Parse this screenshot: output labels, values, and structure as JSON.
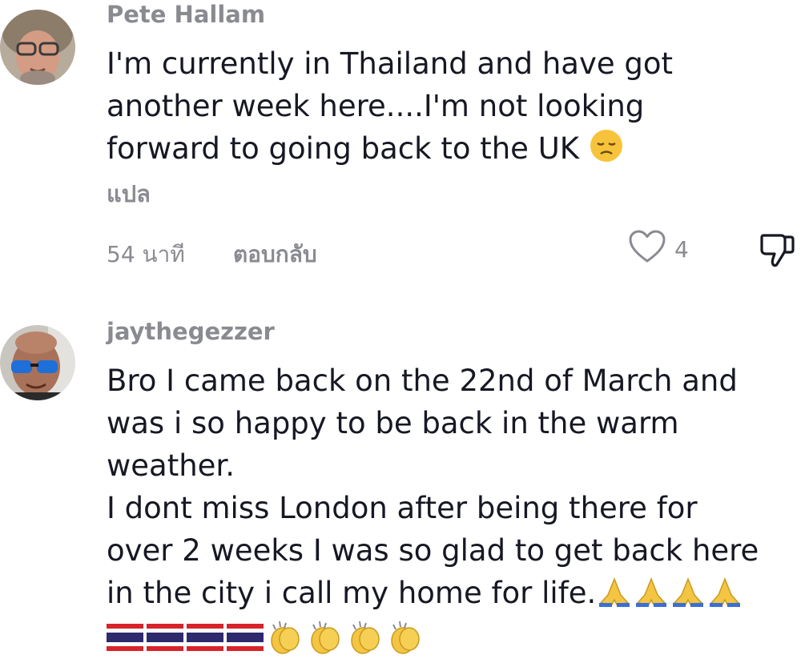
{
  "comments": [
    {
      "username": "Pete Hallam",
      "lines": [
        "I'm currently in Thailand and have got",
        "another week here....I'm not looking",
        "forward to going back to the UK"
      ],
      "translate_label": "แปล",
      "time": "54 นาที",
      "reply_label": "ตอบกลับ",
      "like_count": "4"
    },
    {
      "username": "jaythegezzer",
      "lines": [
        "Bro I came back on the 22nd of March and",
        "was i so happy to be back in the warm",
        "weather.",
        "I dont miss London after being there for",
        "over 2 weeks I was so glad to get back here",
        "in the city i call my home for life."
      ]
    }
  ],
  "icons": {
    "like": "heart-outline-icon",
    "dislike": "thumbs-down-outline-icon"
  },
  "colors": {
    "text": "#161823",
    "muted": "#8a8b91"
  }
}
